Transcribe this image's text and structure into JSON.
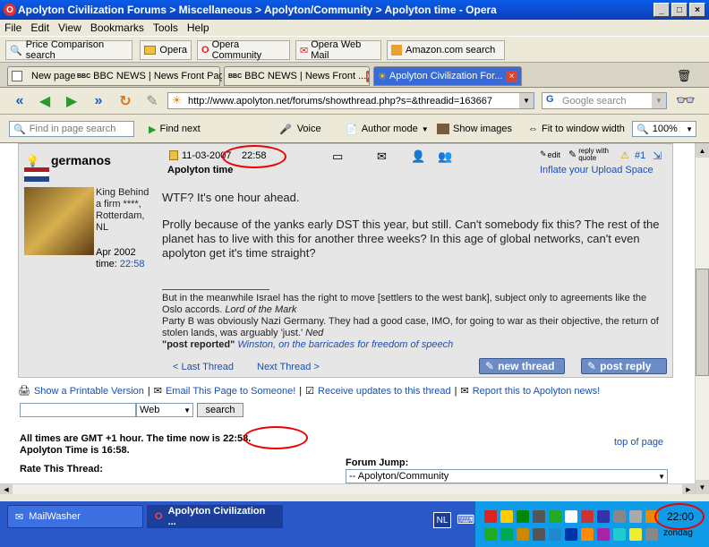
{
  "window": {
    "title": "Apolyton Civilization Forums > Miscellaneous > Apolyton/Community > Apolyton time - Opera"
  },
  "menu": [
    "File",
    "Edit",
    "View",
    "Bookmarks",
    "Tools",
    "Help"
  ],
  "bookmarks": [
    "Price Comparison search",
    "Opera",
    "Opera Community",
    "Opera Web Mail",
    "Amazon.com search"
  ],
  "tabs": [
    "New page",
    "BBC NEWS | News Front Page",
    "BBC NEWS | News Front ...",
    "Apolyton Civilization For..."
  ],
  "address": "http://www.apolyton.net/forums/showthread.php?s=&threadid=163667",
  "google_placeholder": "Google search",
  "findbar": {
    "find_placeholder": "Find in page search",
    "find_next": "Find next",
    "voice": "Voice",
    "author_mode": "Author mode",
    "show_images": "Show images",
    "fit": "Fit to window width",
    "zoom": "100%"
  },
  "post": {
    "author": "germanos",
    "date": "11-03-2007",
    "time": "22:58",
    "title": "Apolyton time",
    "user_title": "King Behind a firm ****, Rotterdam, NL",
    "join": "Apr 2002",
    "time_label": "time:",
    "user_time": "22:58",
    "post_num": "#1",
    "inflate": "Inflate your Upload Space",
    "edit_label": "edit",
    "quote_label": "reply with quote",
    "body1": "WTF? It's one hour ahead.",
    "body2": "Prolly because of the yanks early DST this year, but still. Can't somebody fix this? The rest of the planet has to live with this for another three weeks? In this age of global networks, can't even apolyton get it's time straight?",
    "sig1": "But in the meanwhile Israel has the right to move [settlers to the west bank], subject only to agreements like the Oslo accords.",
    "sig1_it": "Lord of the Mark",
    "sig2": "Party B was obviously Nazi Germany. They had a good case, IMO, for going to war as their objective, the return of stolen lands, was arguably 'just.'",
    "sig2_it": "Ned",
    "sig3": "\"post reported\"",
    "sig3_it": "Winston, on the barricades for freedom of speech"
  },
  "thread": {
    "last": "< Last Thread",
    "next": "Next Thread >",
    "new_thread": "new thread",
    "post_reply": "post reply"
  },
  "tools": [
    "Show a Printable Version",
    "Email This Page to Someone!",
    "Receive updates to this thread",
    "Report this to Apolyton news!"
  ],
  "search": {
    "option": "Web",
    "button": "search"
  },
  "times": {
    "line1_a": "All times are GMT +1 hour. The time now ",
    "line1_b": "is 22:58.",
    "line2": "Apolyton Time is 16:58.",
    "top": "top of page"
  },
  "rate": "Rate This Thread:",
  "jump": {
    "label": "Forum Jump:",
    "value": "-- Apolyton/Community"
  },
  "taskbar": {
    "task1": "MailWasher",
    "task2": "Apolyton Civilization ...",
    "lang": "NL",
    "clock": "22:00",
    "day": "zondag"
  }
}
